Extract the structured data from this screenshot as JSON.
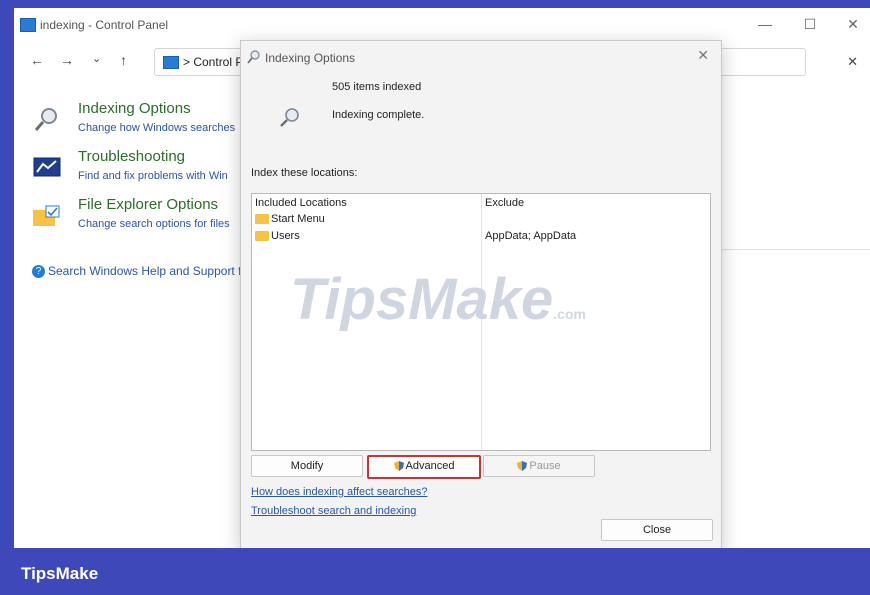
{
  "window": {
    "title": "indexing - Control Panel",
    "minimize": "—",
    "maximize": "☐",
    "close": "✕"
  },
  "nav": {
    "back": "←",
    "forward": "→",
    "recent": "⌄",
    "up": "↑",
    "breadcrumb": "> Control P",
    "clear": "✕"
  },
  "results": [
    {
      "title": "Indexing Options",
      "desc": "Change how Windows searches"
    },
    {
      "title": "Troubleshooting",
      "desc": "Find and fix problems with Win"
    },
    {
      "title": "File Explorer Options",
      "desc": "Change search options for files"
    }
  ],
  "help_link": "Search Windows Help and Support f",
  "dialog": {
    "title": "Indexing Options",
    "close": "✕",
    "items_indexed": "505 items indexed",
    "status": "Indexing complete.",
    "index_label": "Index these locations:",
    "table": {
      "col_included": "Included Locations",
      "col_exclude": "Exclude",
      "rows": [
        {
          "location": "Start Menu",
          "exclude": ""
        },
        {
          "location": "Users",
          "exclude": "AppData; AppData"
        }
      ]
    },
    "buttons": {
      "modify": "Modify",
      "advanced": "Advanced",
      "pause": "Pause",
      "close": "Close"
    },
    "links": {
      "affect": "How does indexing affect searches?",
      "troubleshoot": "Troubleshoot search and indexing"
    },
    "watermark": {
      "main": "TipsMake",
      "suffix": ".com"
    }
  },
  "footer": {
    "brand": "TipsMake"
  },
  "colors": {
    "accent": "#3f48b8",
    "highlight": "#d32f2f",
    "title_green": "#2a6e2a"
  }
}
